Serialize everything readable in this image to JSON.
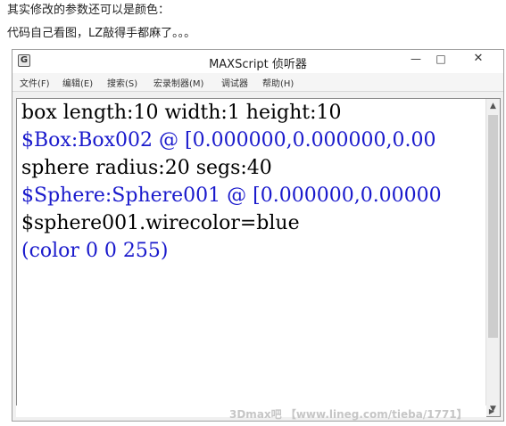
{
  "post": {
    "line1": "其实修改的参数还可以是颜色：",
    "line2": "代码自己看图，LZ敲得手都麻了。。。"
  },
  "window": {
    "title": "MAXScript 侦听器",
    "icon_glyph": "G",
    "controls": {
      "minimize": "—",
      "maximize": "□",
      "close": "✕"
    }
  },
  "menu": {
    "items": [
      "文件(F)",
      "编辑(E)",
      "搜索(S)",
      "宏录制器(M)",
      "调试器",
      "帮助(H)"
    ]
  },
  "listener": {
    "lines": [
      {
        "text": "box length:10 width:1 height:10",
        "kind": "input"
      },
      {
        "text": "$Box:Box002 @ [0.000000,0.000000,0.00",
        "kind": "output"
      },
      {
        "text": "sphere radius:20 segs:40",
        "kind": "input"
      },
      {
        "text": "$Sphere:Sphere001 @ [0.000000,0.00000",
        "kind": "output"
      },
      {
        "text": "$sphere001.wirecolor=blue",
        "kind": "input"
      },
      {
        "text": "(color 0 0 255)",
        "kind": "output"
      }
    ]
  },
  "scrollbar": {
    "up_arrow": "▲",
    "down_arrow": "▼",
    "right_arrow": "▶"
  },
  "watermark": "3Dmax吧 【www.lineg.com/tieba/1771】",
  "colors": {
    "input_text": "#000000",
    "output_text": "#1a1acc"
  }
}
